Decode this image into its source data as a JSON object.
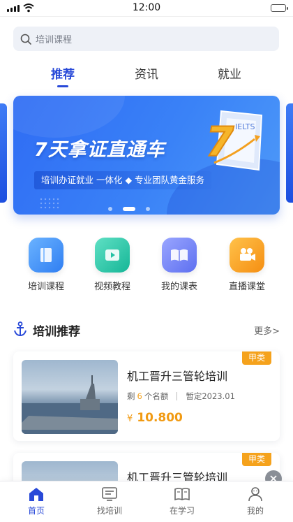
{
  "status_bar": {
    "time": "12:00"
  },
  "search": {
    "placeholder": "培训课程"
  },
  "tabs": [
    {
      "label": "推荐",
      "active": true
    },
    {
      "label": "资讯",
      "active": false
    },
    {
      "label": "就业",
      "active": false
    }
  ],
  "banner": {
    "title": "7天拿证直通车",
    "subtitle": "培训办证就业 一体化 ◆ 专业团队黄金服务",
    "badge_number": "7",
    "badge_text": "IELTS",
    "slide_count": 3,
    "active_slide": 2
  },
  "quick_menu": [
    {
      "label": "培训课程",
      "icon": "book-icon",
      "color": "#3d8ff6"
    },
    {
      "label": "视频教程",
      "icon": "video-icon",
      "color": "#21c1a5"
    },
    {
      "label": "我的课表",
      "icon": "schedule-book-icon",
      "color": "#6f7ff0"
    },
    {
      "label": "直播课堂",
      "icon": "camera-icon",
      "color": "#f7a21e"
    }
  ],
  "section": {
    "title": "培训推荐",
    "more": "更多>",
    "icon": "anchor-icon"
  },
  "courses": [
    {
      "badge": "甲类",
      "title": "机工晋升三管轮培训",
      "remain_prefix": "剩",
      "remain_count": "6",
      "remain_suffix": "个名额",
      "date": "暂定2023.01",
      "currency": "¥",
      "price": "10.800"
    },
    {
      "badge": "甲类",
      "title": "机工晋升三管轮培训"
    }
  ],
  "bottom_nav": [
    {
      "label": "首页",
      "icon": "home-icon",
      "active": true
    },
    {
      "label": "找培训",
      "icon": "search-training-icon",
      "active": false
    },
    {
      "label": "在学习",
      "icon": "study-book-icon",
      "active": false
    },
    {
      "label": "我的",
      "icon": "profile-icon",
      "active": false
    }
  ],
  "colors": {
    "accent": "#2849d8",
    "price": "#f19a12",
    "badge": "#f5a21c"
  }
}
